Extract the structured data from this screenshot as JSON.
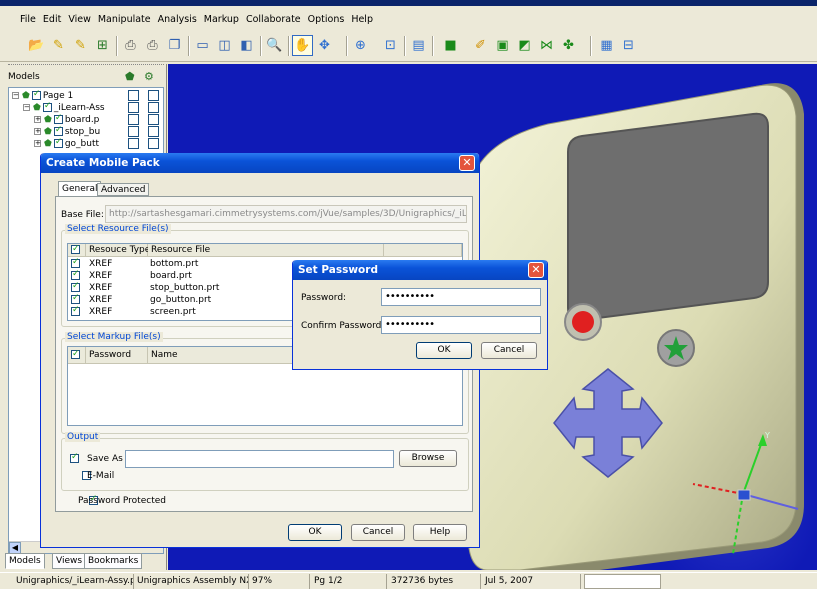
{
  "menu": [
    "File",
    "Edit",
    "View",
    "Manipulate",
    "Analysis",
    "Markup",
    "Collaborate",
    "Options",
    "Help"
  ],
  "toolbar_icons": [
    "open-icon",
    "wand-icon",
    "wand2-icon",
    "tree-icon",
    "print-icon",
    "print-preview-icon",
    "copy-icon",
    "single-view-icon",
    "split-view-icon",
    "dual-view-icon",
    "magnifier-icon",
    "pan-hand-icon",
    "rotate-icon",
    "zoom-icon",
    "fit-icon",
    "comment-icon",
    "solid-icon",
    "paint-icon",
    "box-icon",
    "section-icon",
    "explode-icon",
    "color-icon",
    "measure-icon",
    "dimension-icon"
  ],
  "left_panel": {
    "title": "Models",
    "tree": [
      {
        "label": "Page 1",
        "level": 0
      },
      {
        "label": "_iLearn-Ass",
        "level": 1
      },
      {
        "label": "board.p",
        "level": 2
      },
      {
        "label": "stop_bu",
        "level": 2
      },
      {
        "label": "go_butt",
        "level": 2
      }
    ],
    "tabs": [
      "Models",
      "Views",
      "Bookmarks"
    ]
  },
  "create_dialog": {
    "title": "Create Mobile Pack",
    "tabs": [
      "General",
      "Advanced"
    ],
    "base_file_label": "Base File:",
    "base_file_value": "http://sartashesgamari.cimmetrysystems.com/jVue/samples/3D/Unigraphics/_iLearn-Assy.prt",
    "resource_group": "Select Resource File(s)",
    "resource_columns": [
      "Resouce Type",
      "Resource File"
    ],
    "resource_rows": [
      {
        "type": "XREF",
        "file": "bottom.prt"
      },
      {
        "type": "XREF",
        "file": "board.prt"
      },
      {
        "type": "XREF",
        "file": "stop_button.prt"
      },
      {
        "type": "XREF",
        "file": "go_button.prt"
      },
      {
        "type": "XREF",
        "file": "screen.prt"
      }
    ],
    "markup_group": "Select Markup File(s)",
    "markup_columns": [
      "Password",
      "Name"
    ],
    "output_group": "Output",
    "save_as_label": "Save As",
    "save_as_value": "",
    "browse_label": "Browse",
    "email_label": "E-Mail",
    "password_protected_label": "Password Protected",
    "ok_label": "OK",
    "cancel_label": "Cancel",
    "help_label": "Help"
  },
  "password_dialog": {
    "title": "Set Password",
    "password_label": "Password:",
    "password_value": "••••••••••",
    "confirm_label": "Confirm Password:",
    "confirm_value": "••••••••••",
    "ok_label": "OK",
    "cancel_label": "Cancel"
  },
  "status_bar": {
    "file": "Unigraphics/_iLearn-Assy.prt",
    "format": "Unigraphics Assembly NX4",
    "zoom": "97%",
    "page": "Pg 1/2",
    "size": "372736 bytes",
    "date": "Jul 5, 2007"
  },
  "colors": {
    "viewport_bg": "#0f1ab6",
    "device_body": "#dcdcb4",
    "title_bar": "#0a53d8"
  }
}
